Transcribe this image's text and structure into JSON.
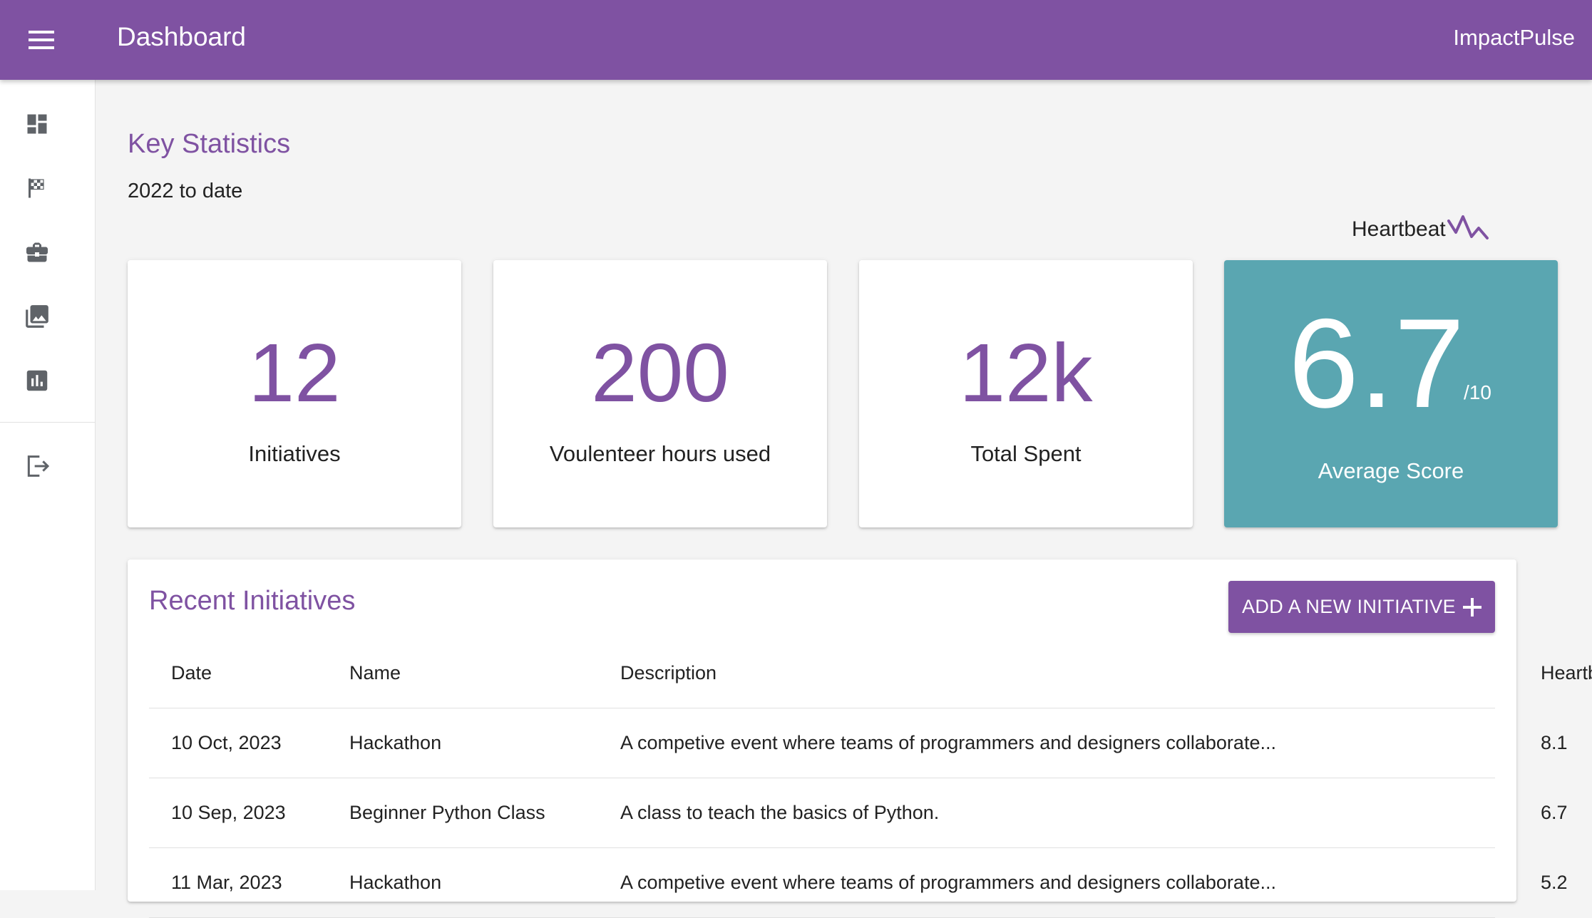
{
  "appbar": {
    "title": "Dashboard",
    "brand": "ImpactPulse",
    "menu_icon": "menu-icon"
  },
  "sidebar": {
    "items": [
      {
        "id": "dashboard",
        "icon": "dashboard-icon"
      },
      {
        "id": "goals",
        "icon": "checkered-flag-icon"
      },
      {
        "id": "initiatives",
        "icon": "briefcase-icon"
      },
      {
        "id": "gallery",
        "icon": "photo-library-icon"
      },
      {
        "id": "reports",
        "icon": "bar-chart-icon"
      }
    ],
    "logout_icon": "logout-icon"
  },
  "stats": {
    "title": "Key Statistics",
    "period": "2022 to date",
    "heartbeat_label": "Heartbeat",
    "cards": [
      {
        "value": "12",
        "label": "Initiatives"
      },
      {
        "value": "200",
        "label": "Voulenteer hours used"
      },
      {
        "value": "12k",
        "label": "Total Spent"
      }
    ],
    "score": {
      "value": "6.7",
      "suffix": "/10",
      "label": "Average Score"
    }
  },
  "recent": {
    "title": "Recent Initiatives",
    "add_button": "ADD A NEW INITIATIVE",
    "columns": {
      "date": "Date",
      "name": "Name",
      "description": "Description",
      "heartbeat": "Heartbeat"
    },
    "rows": [
      {
        "date": "10 Oct, 2023",
        "name": "Hackathon",
        "description": "A competive event where teams of programmers and designers collaborate...",
        "heartbeat": "8.1"
      },
      {
        "date": "10 Sep, 2023",
        "name": "Beginner Python Class",
        "description": "A class to teach the basics of Python.",
        "heartbeat": "6.7"
      },
      {
        "date": "11 Mar, 2023",
        "name": "Hackathon",
        "description": "A competive event where teams of programmers and designers collaborate...",
        "heartbeat": "5.2"
      }
    ]
  },
  "colors": {
    "primary": "#7f52a2",
    "accent": "#5aa6b1",
    "background": "#f4f4f4",
    "icon_gray": "#5f6368"
  }
}
